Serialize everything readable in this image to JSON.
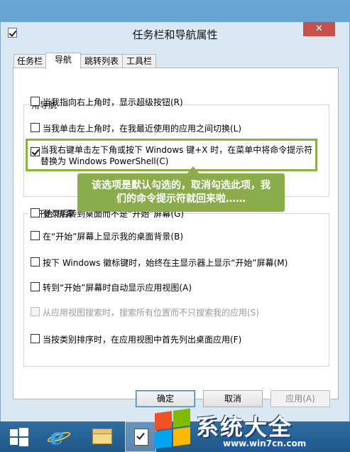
{
  "window": {
    "title": "任务栏和导航属性",
    "close_glyph": "✕"
  },
  "tabs": [
    {
      "label": "任务栏",
      "active": false
    },
    {
      "label": "导航",
      "active": true
    },
    {
      "label": "跳转列表",
      "active": false
    },
    {
      "label": "工具栏",
      "active": false
    }
  ],
  "corner_nav": {
    "group_label": "角导航",
    "options": [
      {
        "label": "当我指向右上角时，显示超级按钮(R)",
        "checked": false
      },
      {
        "label": "当我单击左上角时，在我最近使用的应用之间切换(L)",
        "checked": false
      }
    ],
    "highlighted_option": {
      "line1": "当我右键单击左下角或按下 Windows 键+X 时，在菜单中将命令提示符",
      "line2": "替换为 Windows PowerShell(C)",
      "checked": true
    }
  },
  "callout": {
    "line1": "该选项是默认勾选的，取消勾选此项，我",
    "line2": "们的命令提示符就回来啦……"
  },
  "start_screen": {
    "group_label": "“开始”屏幕",
    "options": [
      {
        "label": "登录后转到桌面而不是“开始”屏幕(G)",
        "checked": false,
        "disabled": false
      },
      {
        "label": "在“开始”屏幕上显示我的桌面背景(B)",
        "checked": false,
        "disabled": false
      },
      {
        "label": "按下 Windows 徽标键时，始终在主显示器上显示“开始”屏幕(M)",
        "checked": false,
        "disabled": false
      },
      {
        "label": "转到“开始”屏幕时自动显示应用视图(A)",
        "checked": false,
        "disabled": false
      },
      {
        "label": "从应用视图搜索时，搜索所有位置而不只搜索我的应用(S)",
        "checked": false,
        "disabled": true
      },
      {
        "label": "当按类别排序时，在应用视图中首先列出桌面应用(F)",
        "checked": false,
        "disabled": false
      }
    ]
  },
  "buttons": {
    "ok": "确定",
    "cancel": "取消",
    "apply": "应用(A)"
  },
  "taskbar": {
    "items": [
      "start-icon",
      "internet-explorer-icon",
      "file-explorer-icon",
      "taskbar-properties-icon"
    ]
  },
  "watermark": {
    "title": "系统大全",
    "url": "www.win7cn.com"
  }
}
